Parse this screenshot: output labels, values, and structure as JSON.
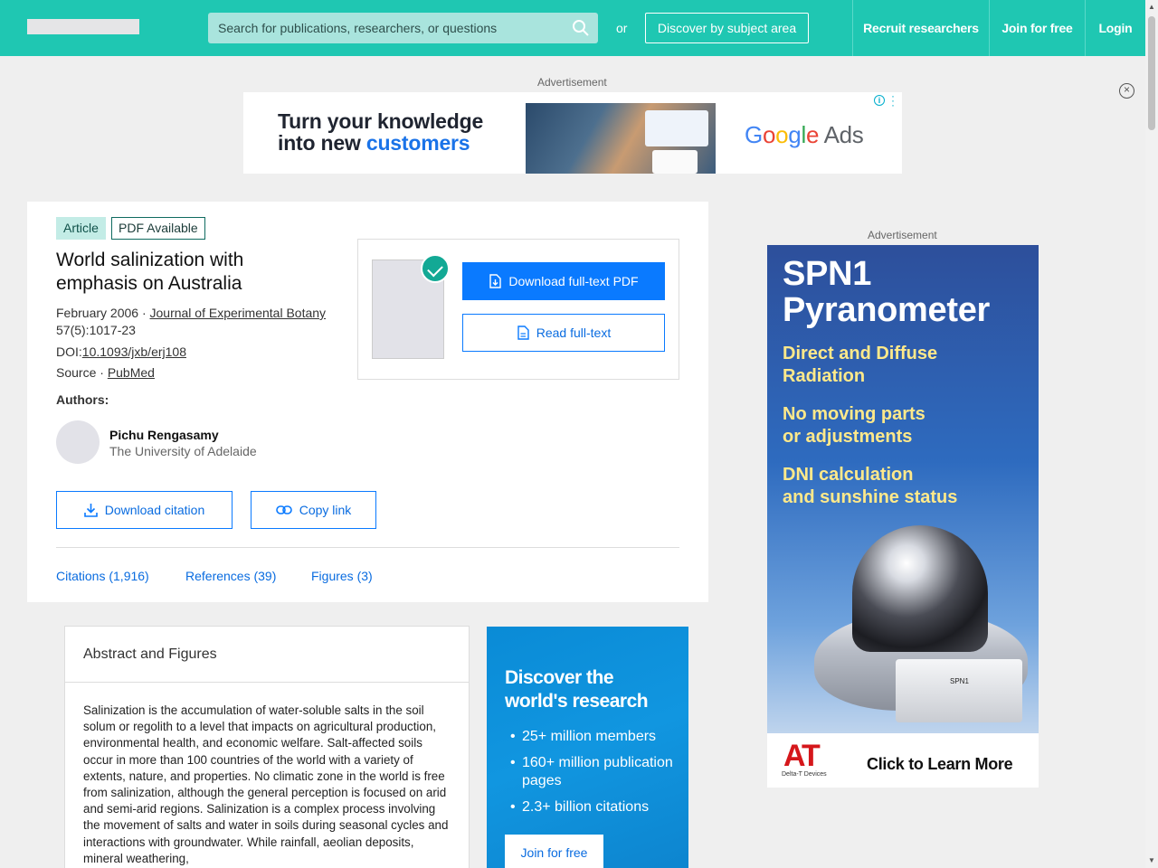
{
  "header": {
    "search_placeholder": "Search for publications, researchers, or questions",
    "or": "or",
    "discover_label": "Discover by subject area",
    "nav": [
      "Recruit researchers",
      "Join for free",
      "Login"
    ]
  },
  "ads": {
    "label": "Advertisement",
    "top": {
      "line1": "Turn your knowledge",
      "line2_prefix": "into new ",
      "line2_accent": "customers",
      "brand_g": "G",
      "brand_o1": "o",
      "brand_o2": "o",
      "brand_g2": "g",
      "brand_l": "l",
      "brand_e": "e",
      "brand_ads": " Ads"
    },
    "side": {
      "title1": "SPN1",
      "title2": "Pyranometer",
      "points": [
        "Direct and Diffuse",
        "Radiation",
        "No moving parts",
        "or adjustments",
        "DNI calculation",
        "and sunshine status"
      ],
      "logo": "AT",
      "logo_sub": "Delta-T Devices",
      "device_label": "SPN1",
      "cta": "Click to Learn More"
    }
  },
  "article": {
    "type_badge": "Article",
    "pdf_badge": "PDF Available",
    "title": "World salinization with emphasis on Australia",
    "date": "February 2006 · ",
    "journal": "Journal of Experimental Botany",
    "volume": "57(5):1017-23",
    "doi_label": "DOI:",
    "doi": "10.1093/jxb/erj108",
    "source_label": "Source · ",
    "source": "PubMed",
    "authors_label": "Authors:",
    "author_name": "Pichu Rengasamy",
    "author_affiliation": "The University of Adelaide",
    "download_pdf": "Download full-text PDF",
    "read_fulltext": "Read full-text",
    "download_citation": "Download citation",
    "copy_link": "Copy link",
    "tabs": [
      "Citations (1,916)",
      "References (39)",
      "Figures (3)"
    ]
  },
  "abstract": {
    "heading": "Abstract and Figures",
    "text": "Salinization is the accumulation of water-soluble salts in the soil solum or regolith to a level that impacts on agricultural production, environmental health, and economic welfare. Salt-affected soils occur in more than 100 countries of the world with a variety of extents, nature, and properties. No climatic zone in the world is free from salinization, although the general perception is focused on arid and semi-arid regions. Salinization is a complex process involving the movement of salts and water in soils during seasonal cycles and interactions with groundwater. While rainfall, aeolian deposits, mineral weathering,"
  },
  "promo": {
    "title": "Discover the world's research",
    "items": [
      "25+ million members",
      "160+ million publication pages",
      "2.3+ billion citations"
    ],
    "button": "Join for free"
  },
  "colors": {
    "brand": "#1fc7b2",
    "link": "#0a6ce0",
    "primary_button": "#0a7aff"
  }
}
